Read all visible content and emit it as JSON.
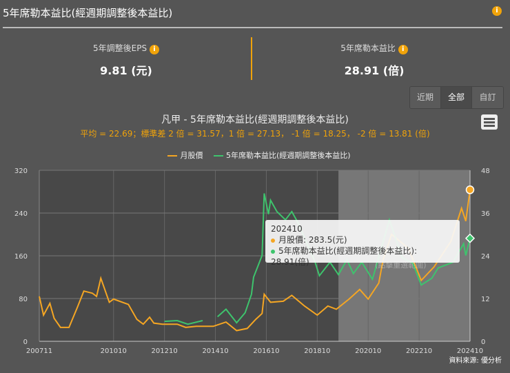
{
  "header": {
    "title": "5年席勒本益比(經週期調整後本益比)",
    "info_icon": "info-icon"
  },
  "stats": [
    {
      "label": "5年調整後EPS",
      "value": "9.81 (元)"
    },
    {
      "label": "5年席勒本益比",
      "value": "28.91 (倍)"
    }
  ],
  "range_buttons": [
    "近期",
    "全部",
    "自訂"
  ],
  "active_range": "全部",
  "colors": {
    "price": "#f5a623",
    "pe": "#3ec46d",
    "accent": "#f0a30a"
  },
  "tooltip": {
    "date": "202410",
    "price_line": "月股價: 283.5(元)",
    "pe_line": "5年席勒本益比(經週期調整後本益比): 28.91(倍)"
  },
  "watermark": "(點擊重選範圍)",
  "source": "資料來源: 優分析",
  "chart_data": {
    "type": "line",
    "title": "凡甲 - 5年席勒本益比(經週期調整後本益比)",
    "subtitle": "平均 = 22.69；標準差 2 倍 = 31.57，1 倍 = 27.13， -1 倍 = 18.25， -2 倍 = 13.81 (倍)",
    "x_start": "200711",
    "x_end": "202410",
    "x_months": 204,
    "x_ticks": [
      "200711",
      "201010",
      "201210",
      "201410",
      "201610",
      "201810",
      "202010",
      "202210",
      "202410"
    ],
    "x_tick_months": [
      0,
      35,
      59,
      83,
      107,
      131,
      155,
      179,
      203
    ],
    "y_left": {
      "ticks": [
        0,
        80,
        160,
        240,
        320
      ],
      "lim": [
        0,
        320
      ]
    },
    "y_right": {
      "ticks": [
        0,
        12,
        24,
        36,
        48
      ],
      "lim": [
        0,
        48
      ]
    },
    "legend": [
      "月股價",
      "5年席勒本益比(經週期調整後本益比)"
    ],
    "selected_range_start_month": 141,
    "series": [
      {
        "name": "月股價",
        "axis": "left",
        "points": [
          [
            0,
            84
          ],
          [
            2,
            49
          ],
          [
            5,
            71
          ],
          [
            7,
            43
          ],
          [
            10,
            26
          ],
          [
            14,
            26
          ],
          [
            18,
            64
          ],
          [
            21,
            94
          ],
          [
            25,
            90
          ],
          [
            27,
            84
          ],
          [
            29,
            118
          ],
          [
            33,
            73
          ],
          [
            35,
            79
          ],
          [
            42,
            69
          ],
          [
            46,
            41
          ],
          [
            49,
            32
          ],
          [
            52,
            45
          ],
          [
            54,
            34
          ],
          [
            58,
            32
          ],
          [
            65,
            32
          ],
          [
            69,
            26
          ],
          [
            74,
            28
          ],
          [
            82,
            28
          ],
          [
            88,
            36
          ],
          [
            93,
            20
          ],
          [
            98,
            24
          ],
          [
            102,
            41
          ],
          [
            105,
            52
          ],
          [
            106,
            88
          ],
          [
            109,
            73
          ],
          [
            115,
            75
          ],
          [
            119,
            86
          ],
          [
            125,
            66
          ],
          [
            131,
            49
          ],
          [
            136,
            66
          ],
          [
            140,
            60
          ],
          [
            146,
            79
          ],
          [
            151,
            97
          ],
          [
            155,
            79
          ],
          [
            160,
            109
          ],
          [
            162,
            152
          ],
          [
            166,
            200
          ],
          [
            174,
            174
          ],
          [
            180,
            114
          ],
          [
            186,
            139
          ],
          [
            194,
            187
          ],
          [
            199,
            249
          ],
          [
            201,
            225
          ],
          [
            203,
            283.5
          ]
        ]
      },
      {
        "name": "5年席勒本益比(經週期調整後本益比)",
        "axis": "right",
        "segments": [
          [
            [
              59,
              5.6
            ],
            [
              65,
              5.8
            ],
            [
              70,
              4.8
            ],
            [
              77,
              5.8
            ]
          ],
          [
            [
              84,
              6.9
            ],
            [
              88,
              9.0
            ],
            [
              93,
              5.2
            ],
            [
              97,
              8.0
            ],
            [
              100,
              13.2
            ],
            [
              101,
              18.0
            ],
            [
              105,
              24.1
            ],
            [
              106,
              41.5
            ],
            [
              108,
              35.7
            ],
            [
              109,
              39.6
            ],
            [
              112,
              36.4
            ],
            [
              116,
              34.1
            ],
            [
              119,
              36.4
            ],
            [
              122,
              33.2
            ],
            [
              130,
              22.2
            ],
            [
              132,
              18.4
            ],
            [
              137,
              22.2
            ],
            [
              141,
              18.7
            ],
            [
              145,
              22.9
            ],
            [
              148,
              19.0
            ],
            [
              152,
              22.2
            ],
            [
              157,
              17.4
            ],
            [
              165,
              34.1
            ],
            [
              171,
              23.5
            ],
            [
              176,
              21.9
            ],
            [
              180,
              15.8
            ],
            [
              185,
              17.7
            ],
            [
              188,
              20.6
            ],
            [
              195,
              22.2
            ],
            [
              200,
              27.4
            ],
            [
              201,
              24.1
            ],
            [
              203,
              28.91
            ]
          ]
        ]
      }
    ]
  }
}
